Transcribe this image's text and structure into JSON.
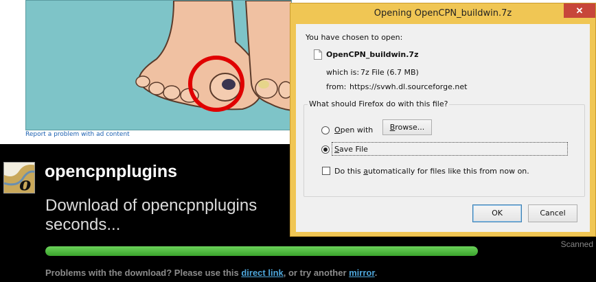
{
  "ad": {
    "report_link": "Report a problem with ad content"
  },
  "page": {
    "project_name": "opencpnplugins",
    "download_message": "Download of opencpnplugins seconds...",
    "progress": 1.0,
    "scanned_text": "Scanned",
    "problems_prefix": "Problems with the download? Please use this ",
    "direct_link": "direct link",
    "problems_middle": ", or try another ",
    "mirror_link": "mirror",
    "problems_suffix": "."
  },
  "dialog": {
    "title": "Opening OpenCPN_buildwin.7z",
    "close_glyph": "✕",
    "chosen_label": "You have chosen to open:",
    "file_name": "OpenCPN_buildwin.7z",
    "which_is_label": "which is:",
    "which_is_value": "7z File (6.7 MB)",
    "from_label": "from:",
    "from_value": "https://svwh.dl.sourceforge.net",
    "group_title": "What should Firefox do with this file?",
    "open_with_label": "Open with",
    "open_with_accel": "O",
    "open_with_rest": "pen with",
    "browse_label": "Browse...",
    "browse_accel": "B",
    "browse_rest": "rowse...",
    "save_file_label": "Save File",
    "save_accel": "S",
    "save_rest": "ave File",
    "auto_prefix": "Do this ",
    "auto_accel": "a",
    "auto_rest": "utomatically for files like this from now on.",
    "selected_option": "Save File",
    "auto_checked": false,
    "ok_label": "OK",
    "cancel_label": "Cancel"
  },
  "colors": {
    "dialog_frame": "#f0c654",
    "close_button": "#c7463a",
    "progress": "#4cb83c",
    "link": "#4ea7dc"
  }
}
